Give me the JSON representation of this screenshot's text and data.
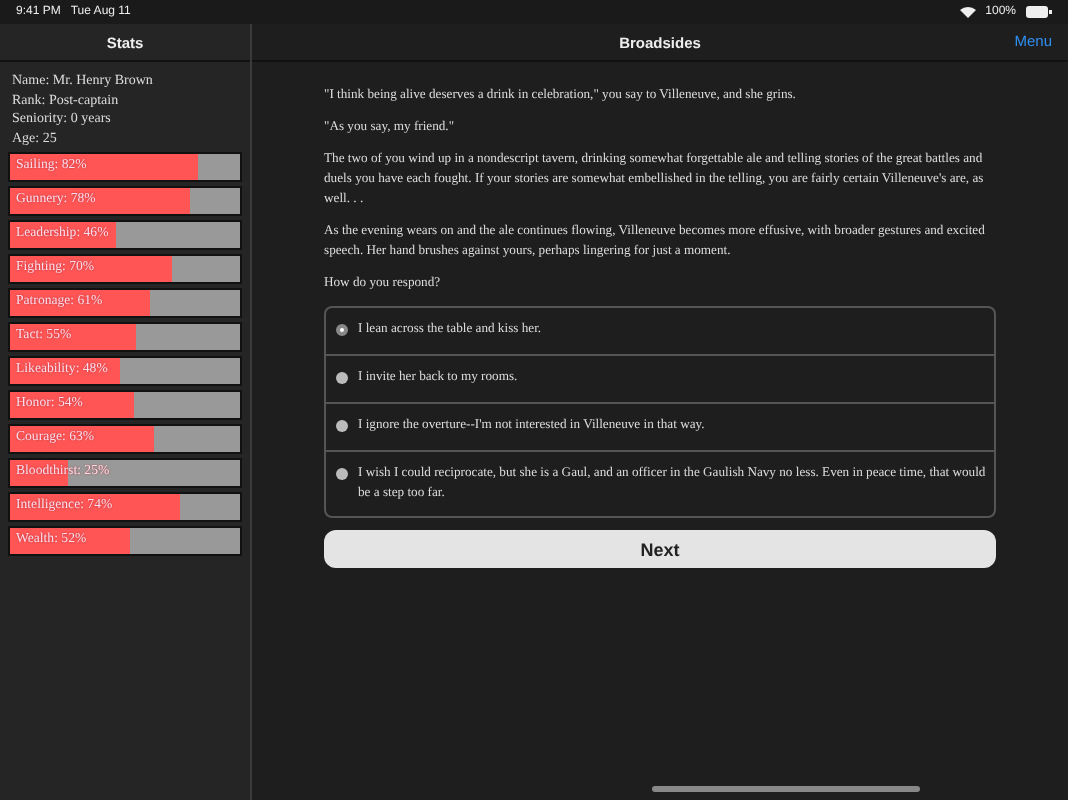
{
  "status_bar": {
    "time": "9:41 PM",
    "date": "Tue Aug 11",
    "battery": "100%"
  },
  "sidebar": {
    "title": "Stats",
    "info": [
      "Name: Mr. Henry Brown",
      "Rank: Post-captain",
      "Seniority: 0 years",
      "Age: 25"
    ],
    "stats": [
      {
        "label": "Sailing: 82%",
        "level": 0.82
      },
      {
        "label": "Gunnery: 78%",
        "level": 0.78
      },
      {
        "label": "Leadership: 46%",
        "level": 0.46
      },
      {
        "label": "Fighting: 70%",
        "level": 0.7
      },
      {
        "label": "Patronage: 61%",
        "level": 0.61
      },
      {
        "label": "Tact: 55%",
        "level": 0.55
      },
      {
        "label": "Likeability: 48%",
        "level": 0.48
      },
      {
        "label": "Honor: 54%",
        "level": 0.54
      },
      {
        "label": "Courage: 63%",
        "level": 0.63
      },
      {
        "label": "Bloodthirst: 25%",
        "level": 0.25
      },
      {
        "label": "Intelligence: 74%",
        "level": 0.74
      },
      {
        "label": "Wealth: 52%",
        "level": 0.52
      }
    ]
  },
  "main": {
    "title": "Broadsides",
    "menu": "Menu",
    "paragraphs": [
      "\"I think being alive deserves a drink in celebration,\" you say to Villeneuve, and she grins.",
      "\"As you say, my friend.\"",
      "The two of you wind up in a nondescript tavern, drinking somewhat forgettable ale and telling stories of the great battles and duels you have each fought. If your stories are somewhat embellished in the telling, you are fairly certain Villeneuve's are, as well. . .",
      "As the evening wears on and the ale continues flowing, Villeneuve becomes more effusive, with broader gestures and excited speech. Her hand brushes against yours, perhaps lingering for just a moment.",
      "How do you respond?"
    ],
    "choices": [
      {
        "label": "I lean across the table and kiss her.",
        "selected": true
      },
      {
        "label": "I invite her back to my rooms.",
        "selected": false
      },
      {
        "label": "I ignore the overture--I'm not interested in Villeneuve in that way.",
        "selected": false
      },
      {
        "label": "I wish I could reciprocate, but she is a Gaul, and an officer in the Gaulish Navy no less. Even in peace time, that would be a step too far.",
        "selected": false
      }
    ],
    "next_button": "Next"
  }
}
